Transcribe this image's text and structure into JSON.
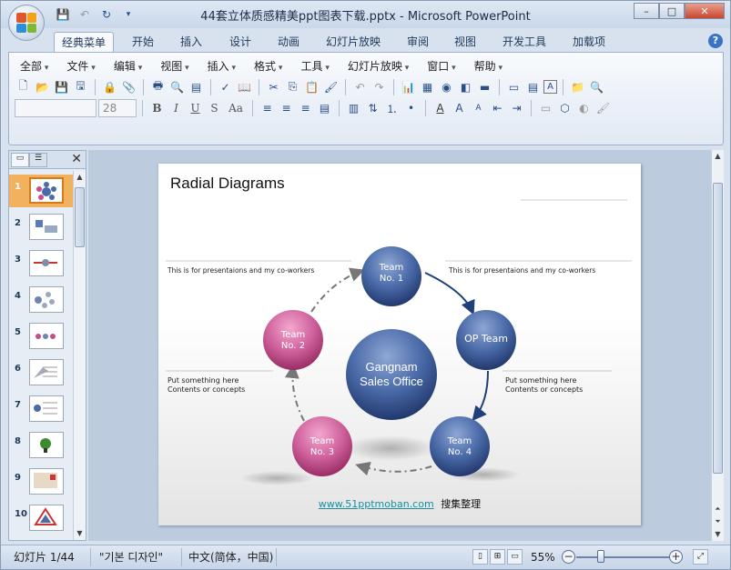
{
  "window": {
    "title": "44套立体质感精美ppt图表下载.pptx - Microsoft PowerPoint",
    "controls": {
      "minimize": "–",
      "maximize": "□",
      "close": "✕"
    }
  },
  "tabs": [
    {
      "label": "经典菜单",
      "active": true
    },
    {
      "label": "开始"
    },
    {
      "label": "插入"
    },
    {
      "label": "设计"
    },
    {
      "label": "动画"
    },
    {
      "label": "幻灯片放映"
    },
    {
      "label": "审阅"
    },
    {
      "label": "视图"
    },
    {
      "label": "开发工具"
    },
    {
      "label": "加载项"
    }
  ],
  "menus": [
    "全部",
    "文件",
    "编辑",
    "视图",
    "插入",
    "格式",
    "工具",
    "幻灯片放映",
    "窗口",
    "帮助"
  ],
  "format": {
    "font_name": "",
    "font_size": "28",
    "bold": "B",
    "italic": "I",
    "underline": "U",
    "shadow": "S",
    "case": "Aa"
  },
  "slides": [
    {
      "num": "1",
      "selected": true
    },
    {
      "num": "2"
    },
    {
      "num": "3"
    },
    {
      "num": "4"
    },
    {
      "num": "5"
    },
    {
      "num": "6"
    },
    {
      "num": "7"
    },
    {
      "num": "8"
    },
    {
      "num": "9"
    },
    {
      "num": "10"
    }
  ],
  "slide": {
    "title": "Radial Diagrams",
    "left_note": "This is for presentaions  and  my co-workers",
    "right_note": "This is for presentaions  and  my co-workers",
    "left_bottom_1": "Put something here",
    "left_bottom_2": "Contents or concepts",
    "right_bottom_1": "Put something here",
    "right_bottom_2": "Contents or concepts",
    "center_1": "Gangnam",
    "center_2": "Sales Office",
    "team1_a": "Team",
    "team1_b": "No. 1",
    "team2_a": "Team",
    "team2_b": "No. 2",
    "team3_a": "Team",
    "team3_b": "No. 3",
    "team4_a": "Team",
    "team4_b": "No. 4",
    "op_team": "OP Team",
    "footer_link": "www.51pptmoban.com",
    "footer_text": "搜集整理",
    "colors": {
      "blue": "#3d5a92",
      "pink": "#c64d8c",
      "arrow": "#1f3f7a"
    }
  },
  "status": {
    "slide_info": "幻灯片 1/44",
    "theme": "\"기본 디자인\"",
    "language": "中文(简体，中国)",
    "zoom": "55%"
  }
}
